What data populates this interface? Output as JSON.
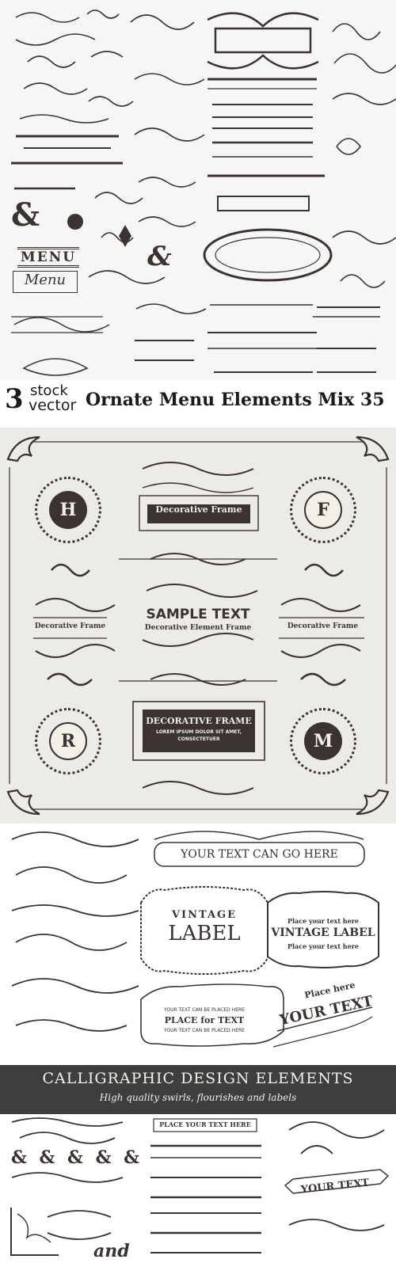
{
  "panel1": {
    "menu_badge": "MENU",
    "menu_script": "Menu",
    "ampersand_1": "&",
    "ampersand_2": "&"
  },
  "banner": {
    "number": "3",
    "word_stock": "stock",
    "word_vector": "vector",
    "title": "Ornate Menu Elements Mix 35"
  },
  "panel2": {
    "monograms": [
      "H",
      "F",
      "R",
      "M"
    ],
    "frame_top": "Decorative Frame",
    "frame_left": "Decorative Frame",
    "frame_right": "Decorative Frame",
    "sample_title": "SAMPLE TEXT",
    "sample_subtitle": "Decorative Element Frame",
    "frame_bottom_title": "DECORATIVE FRAME",
    "frame_bottom_line1": "LOREM IPSUM DOLOR SIT AMET,",
    "frame_bottom_line2": "CONSECTETUER"
  },
  "panel3": {
    "your_text_banner": "YOUR TEXT CAN GO HERE",
    "vintage_1": "VINTAGE",
    "label_1": "LABEL",
    "place_small_1": "Place your text here",
    "vintage_label_2": "VINTAGE LABEL",
    "place_small_2": "Place your text here",
    "tiny_top": "YOUR TEXT CAN BE PLACED HERE",
    "place_for_text": "PLACE for TEXT",
    "tiny_bottom": "YOUR TEXT CAN BE PLACED HERE",
    "place_here": "Place here",
    "your_text": "YOUR TEXT"
  },
  "panel4": {
    "title": "CALLIGRAPHIC DESIGN ELEMENTS",
    "subtitle": "High quality swirls, flourishes and labels"
  },
  "panel5": {
    "ampersands": "& & & & &",
    "place_your_text": "PLACE YOUR TEXT HERE",
    "your_text_ribbon": "YOUR TEXT",
    "and_word": "and"
  },
  "colors": {
    "ink": "#3a3330",
    "panel_gray": "#edebe7",
    "dark_band": "#3e3e3e",
    "light_text": "#f3efe9"
  }
}
